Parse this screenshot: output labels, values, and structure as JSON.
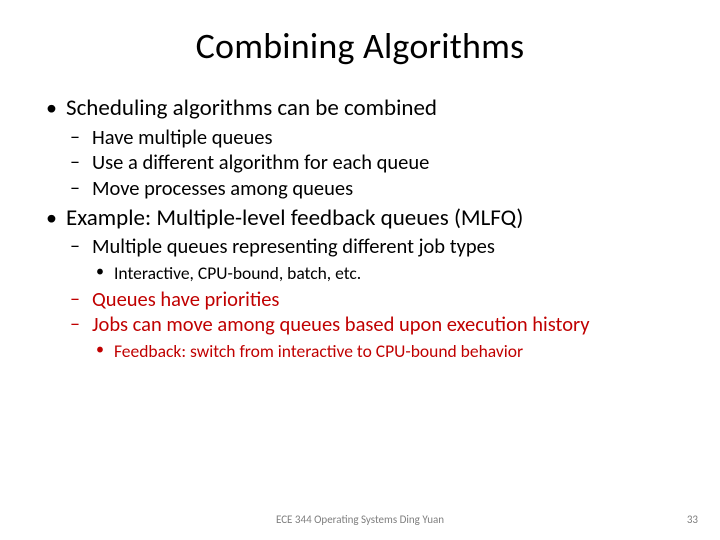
{
  "title": "Combining Algorithms",
  "bullets": {
    "a": {
      "text": "Scheduling algorithms can be combined",
      "sub": {
        "a": "Have multiple queues",
        "b": "Use a different algorithm for each queue",
        "c": "Move processes among queues"
      }
    },
    "b": {
      "text": "Example: Multiple-level feedback queues (MLFQ)",
      "sub": {
        "a": {
          "text": "Multiple queues representing different job types",
          "sub": {
            "a": "Interactive, CPU-bound, batch, etc."
          }
        },
        "b": {
          "text": "Queues have priorities"
        },
        "c": {
          "text": "Jobs can move among queues based upon execution history",
          "sub": {
            "a": "Feedback: switch from interactive to CPU-bound behavior"
          }
        }
      }
    }
  },
  "footer": "ECE 344 Operating Systems Ding Yuan",
  "page": "33"
}
